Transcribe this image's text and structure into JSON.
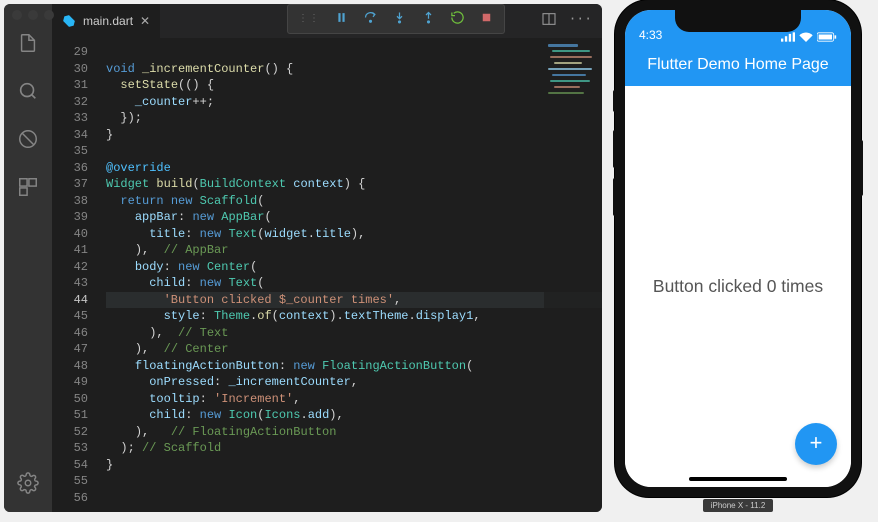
{
  "editor": {
    "file_name": "main.dart",
    "lines": [
      {
        "n": 29,
        "html": ""
      },
      {
        "n": 30,
        "html": "<span class='kw'>void</span> <span class='fn'>_incrementCounter</span><span class='pc'>() {</span>"
      },
      {
        "n": 31,
        "html": "  <span class='fn'>setState</span><span class='pc'>(() {</span>"
      },
      {
        "n": 32,
        "html": "    <span class='pr'>_counter</span><span class='pc'>++;</span>"
      },
      {
        "n": 33,
        "html": "  <span class='pc'>});</span>"
      },
      {
        "n": 34,
        "html": "<span class='pc'>}</span>"
      },
      {
        "n": 35,
        "html": ""
      },
      {
        "n": 36,
        "html": "<span class='at'>@override</span>"
      },
      {
        "n": 37,
        "html": "<span class='ty'>Widget</span> <span class='fn'>build</span><span class='pc'>(</span><span class='ty'>BuildContext</span> <span class='pr'>context</span><span class='pc'>) {</span>"
      },
      {
        "n": 38,
        "html": "  <span class='kw'>return</span> <span class='kw'>new</span> <span class='ty'>Scaffold</span><span class='pc'>(</span>"
      },
      {
        "n": 39,
        "html": "    <span class='pr'>appBar</span><span class='pc'>:</span> <span class='kw'>new</span> <span class='ty'>AppBar</span><span class='pc'>(</span>"
      },
      {
        "n": 40,
        "html": "      <span class='pr'>title</span><span class='pc'>:</span> <span class='kw'>new</span> <span class='ty'>Text</span><span class='pc'>(</span><span class='pr'>widget</span><span class='pc'>.</span><span class='pr'>title</span><span class='pc'>),</span>"
      },
      {
        "n": 41,
        "html": "    <span class='pc'>),  </span><span class='cm'>// AppBar</span>"
      },
      {
        "n": 42,
        "html": "    <span class='pr'>body</span><span class='pc'>:</span> <span class='kw'>new</span> <span class='ty'>Center</span><span class='pc'>(</span>"
      },
      {
        "n": 43,
        "html": "      <span class='pr'>child</span><span class='pc'>:</span> <span class='kw'>new</span> <span class='ty'>Text</span><span class='pc'>(</span>"
      },
      {
        "n": 44,
        "hl": true,
        "html": "        <span class='st'>'Button clicked $_counter times'</span><span class='pc'>,</span>"
      },
      {
        "n": 45,
        "html": "        <span class='pr'>style</span><span class='pc'>:</span> <span class='ty'>Theme</span><span class='pc'>.</span><span class='fn'>of</span><span class='pc'>(</span><span class='pr'>context</span><span class='pc'>).</span><span class='pr'>textTheme</span><span class='pc'>.</span><span class='pr'>display1</span><span class='pc'>,</span>"
      },
      {
        "n": 46,
        "html": "      <span class='pc'>),  </span><span class='cm'>// Text</span>"
      },
      {
        "n": 47,
        "html": "    <span class='pc'>),  </span><span class='cm'>// Center</span>"
      },
      {
        "n": 48,
        "html": "    <span class='pr'>floatingActionButton</span><span class='pc'>:</span> <span class='kw'>new</span> <span class='ty'>FloatingActionButton</span><span class='pc'>(</span>"
      },
      {
        "n": 49,
        "html": "      <span class='pr'>onPressed</span><span class='pc'>:</span> <span class='pr'>_incrementCounter</span><span class='pc'>,</span>"
      },
      {
        "n": 50,
        "html": "      <span class='pr'>tooltip</span><span class='pc'>:</span> <span class='st'>'Increment'</span><span class='pc'>,</span>"
      },
      {
        "n": 51,
        "html": "      <span class='pr'>child</span><span class='pc'>:</span> <span class='kw'>new</span> <span class='ty'>Icon</span><span class='pc'>(</span><span class='ty'>Icons</span><span class='pc'>.</span><span class='pr'>add</span><span class='pc'>),</span>"
      },
      {
        "n": 52,
        "html": "    <span class='pc'>),   </span><span class='cm'>// FloatingActionButton</span>"
      },
      {
        "n": 53,
        "html": "  <span class='pc'>); </span><span class='cm'>// Scaffold</span>"
      },
      {
        "n": 54,
        "html": "<span class='pc'>}</span>"
      },
      {
        "n": 55,
        "html": ""
      },
      {
        "n": 56,
        "html": ""
      }
    ]
  },
  "phone": {
    "status_time": "4:33",
    "app_title": "Flutter Demo Home Page",
    "body_text": "Button clicked 0 times",
    "fab_glyph": "+",
    "sim_label": "iPhone X - 11.2"
  }
}
